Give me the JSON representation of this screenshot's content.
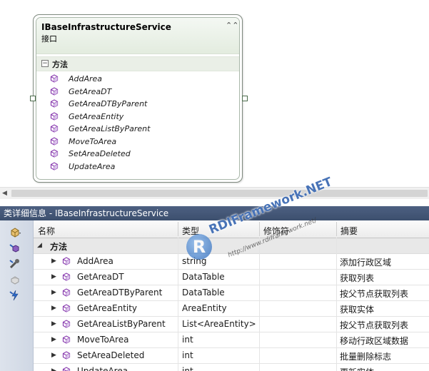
{
  "class_shape": {
    "title": "IBaseInfrastructureService",
    "subtitle": "接口",
    "section_title": "方法",
    "members": [
      "AddArea",
      "GetAreaDT",
      "GetAreaDTByParent",
      "GetAreaEntity",
      "GetAreaListByParent",
      "MoveToArea",
      "SetAreaDeleted",
      "UpdateArea"
    ]
  },
  "details_panel": {
    "title": "类详细信息 - IBaseInfrastructureService",
    "columns": {
      "name": "名称",
      "type": "类型",
      "modifier": "修饰符",
      "summary": "摘要"
    },
    "group_label": "方法",
    "rows": [
      {
        "name": "AddArea",
        "type": "string",
        "summary": "添加行政区域"
      },
      {
        "name": "GetAreaDT",
        "type": "DataTable",
        "summary": "获取列表"
      },
      {
        "name": "GetAreaDTByParent",
        "type": "DataTable",
        "summary": "按父节点获取列表"
      },
      {
        "name": "GetAreaEntity",
        "type": "AreaEntity",
        "summary": "获取实体"
      },
      {
        "name": "GetAreaListByParent",
        "type": "List<AreaEntity>",
        "summary": "按父节点获取列表"
      },
      {
        "name": "MoveToArea",
        "type": "int",
        "summary": "移动行政区域数据"
      },
      {
        "name": "SetAreaDeleted",
        "type": "int",
        "summary": "批量删除标志"
      },
      {
        "name": "UpdateArea",
        "type": "int",
        "summary": "更新实体"
      }
    ]
  },
  "watermark": {
    "brand": "RDIFramework.NET",
    "url": "http://www.rdiframework.net/",
    "logo_letter": "R"
  },
  "icons": {
    "method": "method-cube-icon",
    "toolbar": [
      "new-member-icon",
      "method-icon",
      "property-icon",
      "field-icon",
      "event-icon"
    ]
  },
  "colors": {
    "panel_title_bg": "#4d6082",
    "method_icon": "#8b3fb0",
    "shape_header": "#e3ecdf"
  }
}
